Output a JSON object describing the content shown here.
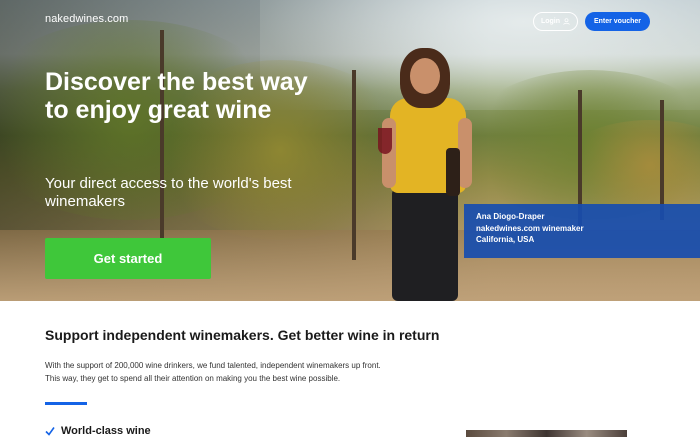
{
  "header": {
    "logo": "nakedwines.com",
    "login_label": "Login",
    "voucher_label": "Enter voucher"
  },
  "hero": {
    "headline": "Discover the best way to enjoy great wine",
    "subhead": "Your direct access to the world's best winemakers",
    "cta_label": "Get started",
    "caption": {
      "name": "Ana Diogo-Draper",
      "role": "nakedwines.com winemaker",
      "location": "California, USA"
    }
  },
  "main": {
    "title": "Support independent winemakers. Get better wine in return",
    "paragraph_lines": [
      "With the support of 200,000 wine drinkers, we fund talented, independent winemakers up front.",
      "This way, they get to spend all their attention on making you the best wine possible."
    ],
    "features": [
      {
        "label": "World-class wine",
        "icon": "checkmark-icon"
      }
    ]
  },
  "colors": {
    "accent_blue": "#1463e6",
    "cta_green": "#3fc73a",
    "caption_blue": "#174daf"
  }
}
